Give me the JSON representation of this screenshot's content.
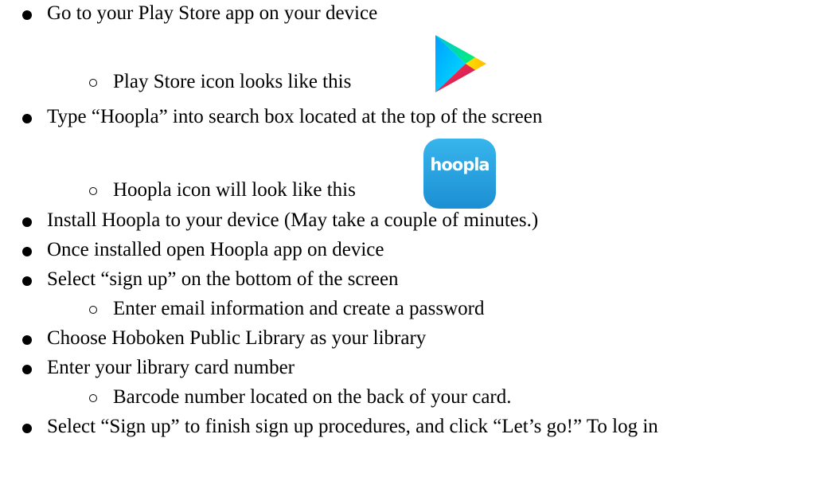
{
  "instructions": [
    {
      "level": 1,
      "text": "Go to your Play Store app on your device"
    },
    {
      "level": 2,
      "text": "Play Store icon looks like this",
      "icon": "play-store-icon"
    },
    {
      "level": 1,
      "text": "Type “Hoopla” into search box located at the top of the screen"
    },
    {
      "level": 2,
      "text": "Hoopla icon will look like this",
      "icon": "hoopla-icon"
    },
    {
      "level": 1,
      "text": "Install Hoopla to your device (May take a couple of minutes.)"
    },
    {
      "level": 1,
      "text": "Once installed open Hoopla app on device"
    },
    {
      "level": 1,
      "text": "Select “sign up” on the bottom of the screen"
    },
    {
      "level": 2,
      "text": "Enter email information and create a password"
    },
    {
      "level": 1,
      "text": "Choose Hoboken Public Library as your library"
    },
    {
      "level": 1,
      "text": "Enter your library card number"
    },
    {
      "level": 2,
      "text": "Barcode number located on the back of your card."
    },
    {
      "level": 1,
      "text": "Select “Sign up” to finish sign up procedures, and click “Let’s go!” To log in"
    }
  ],
  "icons": {
    "hoopla_wordmark": "hoopla",
    "play_store_colors": [
      "#00d7fe",
      "#00f076",
      "#ffd000",
      "#ff3a44"
    ],
    "hoopla_color": "#1f9ad9"
  }
}
